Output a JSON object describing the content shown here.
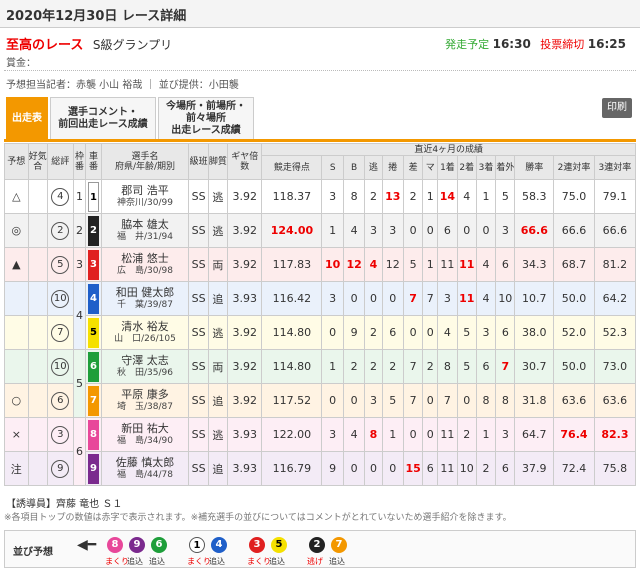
{
  "header": {
    "title": "2020年12月30日 レース詳細"
  },
  "race": {
    "name": "至高のレース",
    "grade": "S級グランプリ",
    "start_label": "発走予定",
    "start_time": "16:30",
    "close_label": "投票締切",
    "close_time": "16:25"
  },
  "prize": "賞金：",
  "credit": "予想担当記者：赤襲 小山 裕哉 ｜ 並び提供：小田襲",
  "tabs": [
    {
      "label": "出走表"
    },
    {
      "label": "選手コメント・\n前回出走レース成績"
    },
    {
      "label": "今場所・前場所・\n前々場所\n出走レース成績"
    }
  ],
  "print_label": "印刷",
  "table": {
    "headers_top": {
      "recent": "直近4ヶ月の成績"
    },
    "headers": [
      "予想",
      "好気合",
      "総評",
      "枠番",
      "車番",
      "選手名\n府県/年齢/期別",
      "級班",
      "脚質",
      "ギヤ倍数",
      "競走得点",
      "S",
      "B",
      "逃",
      "捲",
      "差",
      "マ",
      "1着",
      "2着",
      "3着",
      "着外",
      "勝率",
      "2連対率",
      "3連対率"
    ],
    "rows": [
      {
        "yoso": "△",
        "kiai": "",
        "sohyo": "4",
        "waku": "1",
        "car": "1",
        "name": "郡司 浩平",
        "sub": "神奈川/30/99",
        "kyu": "SS",
        "kyaku": "逃",
        "gear": "3.92",
        "score": "118.37",
        "S": "3",
        "B": "8",
        "nige": "2",
        "makuri": "13",
        "sashi": "2",
        "ma": "1",
        "c1": "14",
        "c2": "4",
        "c3": "1",
        "cg": "5",
        "win": "58.3",
        "r2": "75.0",
        "r3": "79.1"
      },
      {
        "yoso": "◎",
        "kiai": "",
        "sohyo": "2",
        "waku": "2",
        "car": "2",
        "name": "脇本 雄太",
        "sub": "福　井/31/94",
        "kyu": "SS",
        "kyaku": "逃",
        "gear": "3.92",
        "score": "124.00",
        "S": "1",
        "B": "4",
        "nige": "3",
        "makuri": "3",
        "sashi": "0",
        "ma": "0",
        "c1": "6",
        "c2": "0",
        "c3": "0",
        "cg": "3",
        "win": "66.6",
        "r2": "66.6",
        "r3": "66.6"
      },
      {
        "yoso": "▲",
        "kiai": "",
        "sohyo": "5",
        "waku": "3",
        "car": "3",
        "name": "松浦 悠士",
        "sub": "広　島/30/98",
        "kyu": "SS",
        "kyaku": "両",
        "gear": "3.92",
        "score": "117.83",
        "S": "10",
        "B": "12",
        "nige": "4",
        "makuri": "12",
        "sashi": "5",
        "ma": "1",
        "c1": "11",
        "c2": "11",
        "c3": "4",
        "cg": "6",
        "win": "34.3",
        "r2": "68.7",
        "r3": "81.2"
      },
      {
        "yoso": "",
        "kiai": "",
        "sohyo": "10",
        "waku": "4",
        "car": "4",
        "name": "和田 健太郎",
        "sub": "千　葉/39/87",
        "kyu": "SS",
        "kyaku": "追",
        "gear": "3.93",
        "score": "116.42",
        "S": "3",
        "B": "0",
        "nige": "0",
        "makuri": "0",
        "sashi": "7",
        "ma": "7",
        "c1": "3",
        "c2": "11",
        "c3": "4",
        "cg": "10",
        "win": "10.7",
        "r2": "50.0",
        "r3": "64.2"
      },
      {
        "yoso": "",
        "kiai": "",
        "sohyo": "7",
        "waku": "",
        "car": "5",
        "name": "清水 裕友",
        "sub": "山　口/26/105",
        "kyu": "SS",
        "kyaku": "逃",
        "gear": "3.92",
        "score": "114.80",
        "S": "0",
        "B": "9",
        "nige": "2",
        "makuri": "6",
        "sashi": "0",
        "ma": "0",
        "c1": "4",
        "c2": "5",
        "c3": "3",
        "cg": "6",
        "win": "38.0",
        "r2": "52.0",
        "r3": "52.3"
      },
      {
        "yoso": "",
        "kiai": "",
        "sohyo": "10",
        "waku": "5",
        "car": "6",
        "name": "守澤 太志",
        "sub": "秋　田/35/96",
        "kyu": "SS",
        "kyaku": "両",
        "gear": "3.92",
        "score": "114.80",
        "S": "1",
        "B": "2",
        "nige": "2",
        "makuri": "2",
        "sashi": "7",
        "ma": "2",
        "c1": "8",
        "c2": "5",
        "c3": "6",
        "cg": "7",
        "win": "30.7",
        "r2": "50.0",
        "r3": "73.0"
      },
      {
        "yoso": "○",
        "kiai": "",
        "sohyo": "6",
        "waku": "",
        "car": "7",
        "name": "平原 康多",
        "sub": "埼　玉/38/87",
        "kyu": "SS",
        "kyaku": "追",
        "gear": "3.92",
        "score": "117.52",
        "S": "0",
        "B": "0",
        "nige": "3",
        "makuri": "5",
        "sashi": "7",
        "ma": "0",
        "c1": "7",
        "c2": "0",
        "c3": "8",
        "cg": "8",
        "win": "31.8",
        "r2": "63.6",
        "r3": "63.6"
      },
      {
        "yoso": "×",
        "kiai": "",
        "sohyo": "3",
        "waku": "6",
        "car": "8",
        "name": "新田 祐大",
        "sub": "福　島/34/90",
        "kyu": "SS",
        "kyaku": "逃",
        "gear": "3.93",
        "score": "122.00",
        "S": "3",
        "B": "4",
        "nige": "8",
        "makuri": "1",
        "sashi": "0",
        "ma": "0",
        "c1": "11",
        "c2": "2",
        "c3": "1",
        "cg": "3",
        "win": "64.7",
        "r2": "76.4",
        "r3": "82.3"
      },
      {
        "yoso": "注",
        "kiai": "",
        "sohyo": "9",
        "waku": "",
        "car": "9",
        "name": "佐藤 慎太郎",
        "sub": "福　島/44/78",
        "kyu": "SS",
        "kyaku": "追",
        "gear": "3.93",
        "score": "116.79",
        "S": "9",
        "B": "0",
        "nige": "0",
        "makuri": "0",
        "sashi": "15",
        "ma": "6",
        "c1": "11",
        "c2": "10",
        "c3": "2",
        "cg": "6",
        "win": "37.9",
        "r2": "72.4",
        "r3": "75.8"
      }
    ]
  },
  "leader": "【誘導員】齊藤 竜也 Ｓ１",
  "note": "※各項目トップの数値は赤字で表示されます。※補充選手の並びについてはコメントがとれていないため選手紹介を除きます。",
  "yoso": {
    "label": "並び予想",
    "balls": [
      {
        "n": "8",
        "bg": "#e8479a",
        "fg": "#fff"
      },
      {
        "n": "9",
        "bg": "#7b2a8e",
        "fg": "#fff"
      },
      {
        "n": "6",
        "bg": "#1e9e3a",
        "fg": "#fff"
      },
      {
        "n": "1",
        "bg": "#ffffff",
        "fg": "#000"
      },
      {
        "n": "4",
        "bg": "#1f5fc9",
        "fg": "#fff"
      },
      {
        "n": "3",
        "bg": "#e02020",
        "fg": "#fff"
      },
      {
        "n": "5",
        "bg": "#f5e000",
        "fg": "#000"
      },
      {
        "n": "2",
        "bg": "#222222",
        "fg": "#fff"
      },
      {
        "n": "7",
        "bg": "#f39800",
        "fg": "#fff"
      }
    ],
    "tags": [
      "まくり",
      "追込",
      "追込",
      "まくり",
      "追込",
      "まくり",
      "追込",
      "逃げ",
      "追込"
    ]
  },
  "car_colors": [
    "#ffffff",
    "#222222",
    "#e02020",
    "#1f5fc9",
    "#f5e000",
    "#1e9e3a",
    "#f39800",
    "#e8479a",
    "#7b2a8e"
  ],
  "car_fg": [
    "#000",
    "#fff",
    "#fff",
    "#fff",
    "#000",
    "#fff",
    "#fff",
    "#fff",
    "#fff"
  ],
  "row_bg": [
    "#ffffff",
    "#f2f2f2",
    "#fdecec",
    "#eaf1fb",
    "#fffce6",
    "#eaf6ec",
    "#fff3e3",
    "#fdeef5",
    "#f3ebf6"
  ]
}
